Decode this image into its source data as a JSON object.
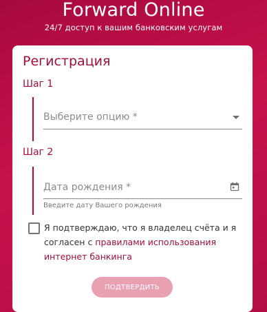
{
  "header": {
    "title": "Forward Online",
    "subtitle": "24/7 доступ к вашим банковским услугам"
  },
  "form": {
    "title": "Регистрация",
    "step1": {
      "label": "Шаг 1",
      "select_placeholder": "Выберите опцию *"
    },
    "step2": {
      "label": "Шаг 2",
      "date_placeholder": "Дата рождения *",
      "hint": "Введите дату Вашего рождения"
    },
    "consent": {
      "text_before": "Я подтверждаю, что я владелец счёта и я согласен с ",
      "link_text": "правилами использования интернет банкинга",
      "checked": false
    },
    "submit_label": "ПОДТВЕРДИТЬ"
  },
  "colors": {
    "accent": "#a30d3b",
    "background": "#c8124c",
    "button_disabled": "#e9a1b2"
  },
  "icons": {
    "select": "chevron-down-icon",
    "date": "calendar-icon"
  }
}
